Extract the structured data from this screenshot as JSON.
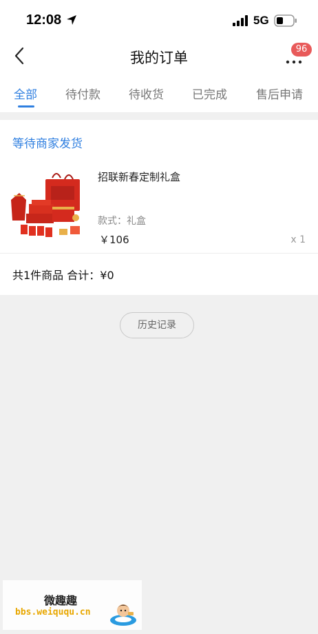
{
  "status_bar": {
    "time": "12:08",
    "network": "5G"
  },
  "nav": {
    "title": "我的订单",
    "badge_count": "96"
  },
  "tabs": [
    {
      "label": "全部",
      "active": true
    },
    {
      "label": "待付款",
      "active": false
    },
    {
      "label": "待收货",
      "active": false
    },
    {
      "label": "已完成",
      "active": false
    },
    {
      "label": "售后申请",
      "active": false
    }
  ],
  "order": {
    "status": "等待商家发货",
    "product_name": "招联新春定制礼盒",
    "spec": "款式：礼盒",
    "price": "￥106",
    "quantity": "x 1",
    "summary": "共1件商品 合计：¥0"
  },
  "history_button": "历史记录",
  "watermark": {
    "title": "微趣趣",
    "url": "bbs.weiququ.cn"
  },
  "colors": {
    "accent": "#2f7fe0",
    "badge": "#e85a5a",
    "product_red": "#d42a1e"
  }
}
